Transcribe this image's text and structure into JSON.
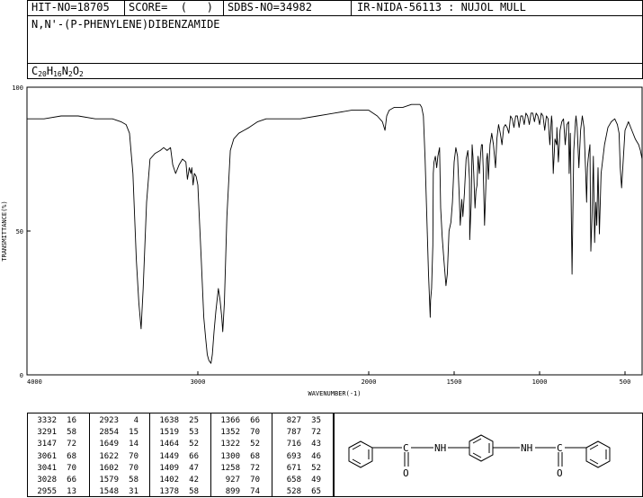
{
  "header": {
    "hit_no": "HIT-NO=18705",
    "score": "SCORE=  (   )",
    "sdbs_no": "SDBS-NO=34982",
    "ir_nida": "IR-NIDA-56113 : NUJOL MULL"
  },
  "compound_name": "N,N'-(P-PHENYLENE)DIBENZAMIDE",
  "formula": {
    "parts": [
      {
        "t": "C",
        "sub": false
      },
      {
        "t": "20",
        "sub": true
      },
      {
        "t": "H",
        "sub": false
      },
      {
        "t": "16",
        "sub": true
      },
      {
        "t": "N",
        "sub": false
      },
      {
        "t": "2",
        "sub": true
      },
      {
        "t": "O",
        "sub": false
      },
      {
        "t": "2",
        "sub": true
      }
    ]
  },
  "chart_data": {
    "type": "line",
    "xlabel": "WAVENUMBER(-1)",
    "ylabel": "TRANSMITTANCE(%)",
    "xlim": [
      4000,
      400
    ],
    "ylim": [
      0,
      100
    ],
    "x_ticks": [
      4000,
      3000,
      2000,
      1500,
      1000,
      500
    ],
    "y_ticks": [
      0,
      50,
      100
    ],
    "series": [
      {
        "x": [
          4000,
          3900,
          3800,
          3700,
          3600,
          3500,
          3450,
          3420,
          3400,
          3380,
          3360,
          3345,
          3332,
          3320,
          3300,
          3280,
          3250,
          3220,
          3200,
          3180,
          3160,
          3147,
          3130,
          3110,
          3090,
          3070,
          3061,
          3050,
          3041,
          3035,
          3028,
          3020,
          3010,
          3000,
          2980,
          2965,
          2955,
          2945,
          2935,
          2923,
          2915,
          2905,
          2895,
          2880,
          2870,
          2860,
          2854,
          2845,
          2830,
          2810,
          2790,
          2760,
          2730,
          2700,
          2650,
          2600,
          2500,
          2400,
          2300,
          2200,
          2100,
          2050,
          2000,
          1950,
          1920,
          1905,
          1895,
          1880,
          1850,
          1800,
          1750,
          1720,
          1700,
          1690,
          1680,
          1670,
          1660,
          1650,
          1640,
          1638,
          1632,
          1625,
          1622,
          1618,
          1610,
          1602,
          1595,
          1585,
          1579,
          1570,
          1560,
          1548,
          1540,
          1530,
          1519,
          1510,
          1500,
          1490,
          1480,
          1470,
          1464,
          1455,
          1449,
          1440,
          1430,
          1420,
          1410,
          1409,
          1400,
          1395,
          1390,
          1385,
          1378,
          1372,
          1366,
          1360,
          1352,
          1345,
          1340,
          1335,
          1330,
          1322,
          1315,
          1310,
          1305,
          1300,
          1290,
          1280,
          1270,
          1258,
          1250,
          1240,
          1230,
          1220,
          1210,
          1200,
          1190,
          1180,
          1170,
          1160,
          1150,
          1140,
          1130,
          1120,
          1110,
          1100,
          1090,
          1080,
          1070,
          1060,
          1050,
          1040,
          1030,
          1020,
          1010,
          1000,
          990,
          980,
          970,
          960,
          950,
          940,
          930,
          927,
          920,
          910,
          900,
          899,
          890,
          880,
          870,
          860,
          850,
          840,
          830,
          827,
          820,
          810,
          800,
          790,
          787,
          780,
          770,
          760,
          750,
          740,
          730,
          725,
          720,
          716,
          710,
          705,
          700,
          693,
          685,
          678,
          671,
          665,
          658,
          650,
          640,
          620,
          600,
          580,
          560,
          545,
          535,
          528,
          520,
          510,
          500,
          480,
          460,
          440,
          420,
          410,
          400
        ],
        "y": [
          89,
          89,
          90,
          90,
          89,
          89,
          88,
          87,
          84,
          70,
          40,
          25,
          16,
          30,
          60,
          75,
          77,
          78,
          79,
          78,
          79,
          73,
          70,
          73,
          75,
          74,
          68,
          72,
          70,
          72,
          66,
          70,
          69,
          66,
          40,
          20,
          13,
          7,
          5,
          4,
          7,
          15,
          22,
          30,
          26,
          20,
          15,
          25,
          55,
          78,
          82,
          84,
          85,
          86,
          88,
          89,
          89,
          89,
          90,
          91,
          92,
          92,
          92,
          90,
          88,
          85,
          90,
          92,
          93,
          93,
          94,
          94,
          94,
          93,
          90,
          75,
          55,
          35,
          20,
          26,
          30,
          45,
          70,
          74,
          76,
          72,
          76,
          79,
          58,
          48,
          40,
          31,
          35,
          50,
          53,
          60,
          74,
          79,
          76,
          62,
          52,
          61,
          55,
          63,
          75,
          78,
          68,
          47,
          60,
          80,
          76,
          70,
          58,
          64,
          66,
          76,
          70,
          77,
          80,
          80,
          72,
          52,
          65,
          75,
          77,
          68,
          80,
          84,
          80,
          72,
          82,
          87,
          84,
          80,
          86,
          87,
          86,
          84,
          90,
          89,
          86,
          90,
          90,
          86,
          90,
          90,
          87,
          91,
          90,
          87,
          91,
          91,
          88,
          91,
          90,
          87,
          91,
          90,
          85,
          90,
          89,
          80,
          90,
          88,
          70,
          82,
          80,
          86,
          74,
          85,
          88,
          89,
          80,
          87,
          88,
          70,
          84,
          35,
          78,
          88,
          90,
          86,
          72,
          85,
          90,
          86,
          70,
          60,
          72,
          75,
          78,
          80,
          43,
          55,
          76,
          46,
          60,
          52,
          72,
          49,
          70,
          80,
          86,
          88,
          89,
          87,
          84,
          72,
          65,
          75,
          85,
          88,
          85,
          82,
          80,
          78,
          75
        ]
      }
    ],
    "grid": false,
    "legend": "none"
  },
  "peak_table": {
    "columns": [
      [
        [
          "3332",
          "16"
        ],
        [
          "3291",
          "58"
        ],
        [
          "3147",
          "72"
        ],
        [
          "3061",
          "68"
        ],
        [
          "3041",
          "70"
        ],
        [
          "3028",
          "66"
        ],
        [
          "2955",
          "13"
        ]
      ],
      [
        [
          "2923",
          "4"
        ],
        [
          "2854",
          "15"
        ],
        [
          "1649",
          "14"
        ],
        [
          "1622",
          "70"
        ],
        [
          "1602",
          "70"
        ],
        [
          "1579",
          "58"
        ],
        [
          "1548",
          "31"
        ]
      ],
      [
        [
          "1638",
          "25"
        ],
        [
          "1519",
          "53"
        ],
        [
          "1464",
          "52"
        ],
        [
          "1449",
          "66"
        ],
        [
          "1409",
          "47"
        ],
        [
          "1402",
          "42"
        ],
        [
          "1378",
          "58"
        ]
      ],
      [
        [
          "1366",
          "66"
        ],
        [
          "1352",
          "70"
        ],
        [
          "1322",
          "52"
        ],
        [
          "1300",
          "68"
        ],
        [
          "1258",
          "72"
        ],
        [
          "927",
          "70"
        ],
        [
          "899",
          "74"
        ]
      ],
      [
        [
          "827",
          "35"
        ],
        [
          "787",
          "72"
        ],
        [
          "716",
          "43"
        ],
        [
          "693",
          "46"
        ],
        [
          "671",
          "52"
        ],
        [
          "658",
          "49"
        ],
        [
          "528",
          "65"
        ]
      ]
    ]
  },
  "structure": {
    "labels": {
      "c1": "C",
      "nh1": "NH",
      "nh2": "NH",
      "c2": "C",
      "o1": "O",
      "o2": "O"
    }
  }
}
